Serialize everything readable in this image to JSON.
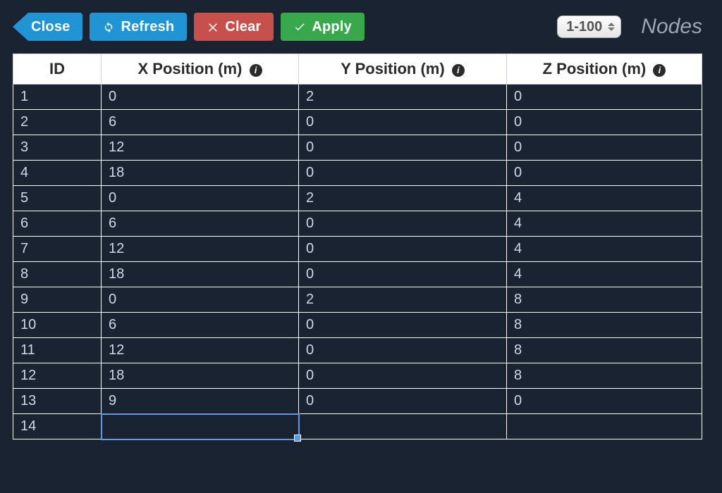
{
  "toolbar": {
    "close_label": "Close",
    "refresh_label": "Refresh",
    "clear_label": "Clear",
    "apply_label": "Apply",
    "range_selected": "1-100"
  },
  "panel": {
    "title": "Nodes"
  },
  "table": {
    "columns": {
      "id": {
        "label": "ID",
        "info": false
      },
      "x": {
        "label": "X Position (m)",
        "info": true
      },
      "y": {
        "label": "Y Position (m)",
        "info": true
      },
      "z": {
        "label": "Z Position (m)",
        "info": true
      }
    },
    "rows": [
      {
        "id": "1",
        "x": "0",
        "y": "2",
        "z": "0"
      },
      {
        "id": "2",
        "x": "6",
        "y": "0",
        "z": "0"
      },
      {
        "id": "3",
        "x": "12",
        "y": "0",
        "z": "0"
      },
      {
        "id": "4",
        "x": "18",
        "y": "0",
        "z": "0"
      },
      {
        "id": "5",
        "x": "0",
        "y": "2",
        "z": "4"
      },
      {
        "id": "6",
        "x": "6",
        "y": "0",
        "z": "4"
      },
      {
        "id": "7",
        "x": "12",
        "y": "0",
        "z": "4"
      },
      {
        "id": "8",
        "x": "18",
        "y": "0",
        "z": "4"
      },
      {
        "id": "9",
        "x": "0",
        "y": "2",
        "z": "8"
      },
      {
        "id": "10",
        "x": "6",
        "y": "0",
        "z": "8"
      },
      {
        "id": "11",
        "x": "12",
        "y": "0",
        "z": "8"
      },
      {
        "id": "12",
        "x": "18",
        "y": "0",
        "z": "8"
      },
      {
        "id": "13",
        "x": "9",
        "y": "0",
        "z": "0"
      },
      {
        "id": "14",
        "x": "",
        "y": "",
        "z": ""
      }
    ],
    "selected_cell": {
      "row_index": 13,
      "column": "x"
    }
  }
}
